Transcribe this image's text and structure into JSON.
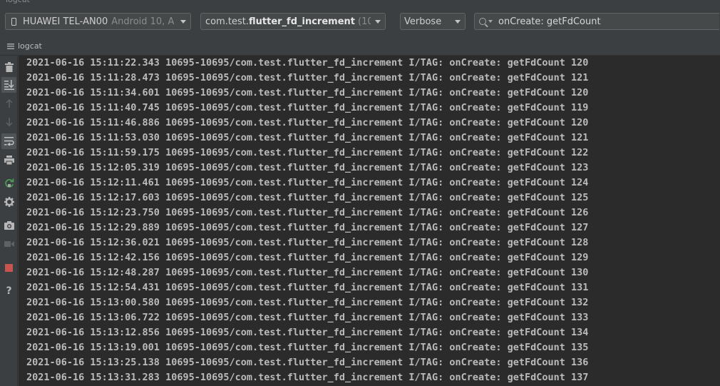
{
  "window": {
    "title_cut": "logcat"
  },
  "toolbar": {
    "device": {
      "name": "HUAWEI TEL-AN00",
      "detail": "Android 10, A"
    },
    "package": {
      "prefix": "com.test.",
      "bold": "flutter_fd_increment",
      "pid": "(10"
    },
    "level": {
      "value": "Verbose"
    },
    "search": {
      "value": "onCreate: getFdCount"
    }
  },
  "tab": {
    "label": "logcat"
  },
  "sidebar": [
    {
      "name": "trash-icon"
    },
    {
      "name": "scroll-to-end-icon",
      "active": true
    },
    {
      "name": "arrow-up-icon"
    },
    {
      "name": "arrow-down-icon"
    },
    {
      "name": "soft-wrap-icon",
      "active": true
    },
    {
      "name": "print-icon"
    },
    {
      "name": "restart-icon"
    },
    {
      "name": "gear-icon"
    },
    {
      "name": "camera-icon"
    },
    {
      "name": "video-icon"
    },
    {
      "name": "stop-icon"
    },
    {
      "name": "help-icon"
    }
  ],
  "colors": {
    "console_bg": "#2b2b2b",
    "text": "#bbbbbb",
    "panel_bg": "#3c3f41",
    "stop_red": "#c75450",
    "restart_green": "#499c54"
  },
  "log_lines": [
    "2021-06-16 15:11:22.343 10695-10695/com.test.flutter_fd_increment I/TAG: onCreate: getFdCount 120",
    "2021-06-16 15:11:28.473 10695-10695/com.test.flutter_fd_increment I/TAG: onCreate: getFdCount 121",
    "2021-06-16 15:11:34.601 10695-10695/com.test.flutter_fd_increment I/TAG: onCreate: getFdCount 120",
    "2021-06-16 15:11:40.745 10695-10695/com.test.flutter_fd_increment I/TAG: onCreate: getFdCount 119",
    "2021-06-16 15:11:46.886 10695-10695/com.test.flutter_fd_increment I/TAG: onCreate: getFdCount 120",
    "2021-06-16 15:11:53.030 10695-10695/com.test.flutter_fd_increment I/TAG: onCreate: getFdCount 121",
    "2021-06-16 15:11:59.175 10695-10695/com.test.flutter_fd_increment I/TAG: onCreate: getFdCount 122",
    "2021-06-16 15:12:05.319 10695-10695/com.test.flutter_fd_increment I/TAG: onCreate: getFdCount 123",
    "2021-06-16 15:12:11.461 10695-10695/com.test.flutter_fd_increment I/TAG: onCreate: getFdCount 124",
    "2021-06-16 15:12:17.603 10695-10695/com.test.flutter_fd_increment I/TAG: onCreate: getFdCount 125",
    "2021-06-16 15:12:23.750 10695-10695/com.test.flutter_fd_increment I/TAG: onCreate: getFdCount 126",
    "2021-06-16 15:12:29.889 10695-10695/com.test.flutter_fd_increment I/TAG: onCreate: getFdCount 127",
    "2021-06-16 15:12:36.021 10695-10695/com.test.flutter_fd_increment I/TAG: onCreate: getFdCount 128",
    "2021-06-16 15:12:42.156 10695-10695/com.test.flutter_fd_increment I/TAG: onCreate: getFdCount 129",
    "2021-06-16 15:12:48.287 10695-10695/com.test.flutter_fd_increment I/TAG: onCreate: getFdCount 130",
    "2021-06-16 15:12:54.431 10695-10695/com.test.flutter_fd_increment I/TAG: onCreate: getFdCount 131",
    "2021-06-16 15:13:00.580 10695-10695/com.test.flutter_fd_increment I/TAG: onCreate: getFdCount 132",
    "2021-06-16 15:13:06.722 10695-10695/com.test.flutter_fd_increment I/TAG: onCreate: getFdCount 133",
    "2021-06-16 15:13:12.856 10695-10695/com.test.flutter_fd_increment I/TAG: onCreate: getFdCount 134",
    "2021-06-16 15:13:19.001 10695-10695/com.test.flutter_fd_increment I/TAG: onCreate: getFdCount 135",
    "2021-06-16 15:13:25.138 10695-10695/com.test.flutter_fd_increment I/TAG: onCreate: getFdCount 136",
    "2021-06-16 15:13:31.283 10695-10695/com.test.flutter_fd_increment I/TAG: onCreate: getFdCount 137"
  ]
}
